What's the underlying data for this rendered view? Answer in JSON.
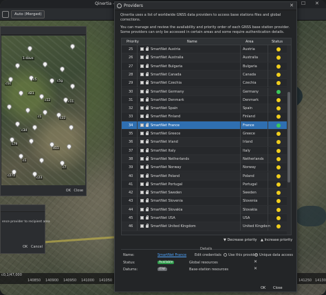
{
  "app": {
    "title": "Qinertia - C:\\",
    "toolbar_select": "Auto (Merged)",
    "min_icon": "—",
    "max_icon": "☐",
    "close_icon": "✕",
    "coordinates": "c0,1/47,000",
    "ruler": [
      "140850",
      "140900",
      "140950",
      "141000",
      "141050",
      "141100",
      "141150",
      "141200",
      "141250",
      "141300"
    ]
  },
  "left_dialog": {
    "ok": "OK",
    "close": "Close",
    "pins": [
      "1-dave",
      "c1s",
      "c5",
      "c2",
      "c5g",
      "c3",
      "d21",
      "c12",
      "c1c",
      "c5a",
      "c8",
      "c11",
      "c4",
      "c22",
      "c1",
      "c7e",
      "c3d",
      "c13",
      "rec",
      "c2",
      "c79",
      "c50",
      "d11",
      "c19",
      "c12",
      "c2",
      "c1",
      "c15",
      "c3d",
      "c9",
      "c7",
      "c5",
      "c17",
      "c23",
      "c10",
      "c12",
      "c272"
    ]
  },
  "small_dialog": {
    "message": "ence provider to recipient area",
    "ok": "OK",
    "cancel": "Cancel"
  },
  "providers": {
    "title": "Providers",
    "close_icon": "✕",
    "intro": "Qinertia uses a list of worldwide GNSS data providers to access base stations files and global corrections.",
    "intro2": "You can manage and review the availability and priority order of each GNSS base station provider. Some providers can only be accessed in certain areas and some require authentication details.",
    "columns": {
      "priority": "Priority",
      "name": "Name",
      "area": "Area",
      "status": "Status"
    },
    "rows": [
      {
        "priority": "25",
        "name": "SmartNet Austria",
        "area": "Austria",
        "status": "yellow"
      },
      {
        "priority": "26",
        "name": "SmartNet Australia",
        "area": "Australia",
        "status": "yellow"
      },
      {
        "priority": "27",
        "name": "SmartNet Bulgaria",
        "area": "Bulgaria",
        "status": "yellow"
      },
      {
        "priority": "28",
        "name": "SmartNet Canada",
        "area": "Canada",
        "status": "yellow"
      },
      {
        "priority": "29",
        "name": "SmartNet Czechia",
        "area": "Czechia",
        "status": "yellow"
      },
      {
        "priority": "30",
        "name": "SmartNet Germany",
        "area": "Germany",
        "status": "green"
      },
      {
        "priority": "31",
        "name": "SmartNet Denmark",
        "area": "Denmark",
        "status": "yellow"
      },
      {
        "priority": "32",
        "name": "SmartNet Spain",
        "area": "Spain",
        "status": "yellow"
      },
      {
        "priority": "33",
        "name": "SmartNet Finland",
        "area": "Finland",
        "status": "yellow"
      },
      {
        "priority": "34",
        "name": "SmartNet France",
        "area": "France",
        "status": "green",
        "selected": true
      },
      {
        "priority": "35",
        "name": "SmartNet Greece",
        "area": "Greece",
        "status": "yellow"
      },
      {
        "priority": "36",
        "name": "SmartNet Irland",
        "area": "Irland",
        "status": "yellow"
      },
      {
        "priority": "37",
        "name": "SmartNet Italy",
        "area": "Italy",
        "status": "yellow"
      },
      {
        "priority": "38",
        "name": "SmartNet Netherlands",
        "area": "Netherlands",
        "status": "yellow"
      },
      {
        "priority": "39",
        "name": "SmartNet Norway",
        "area": "Norway",
        "status": "yellow"
      },
      {
        "priority": "40",
        "name": "SmartNet Poland",
        "area": "Poland",
        "status": "yellow"
      },
      {
        "priority": "41",
        "name": "SmartNet Portugal",
        "area": "Portugal",
        "status": "yellow"
      },
      {
        "priority": "42",
        "name": "SmartNet Sweden",
        "area": "Sweden",
        "status": "yellow"
      },
      {
        "priority": "43",
        "name": "SmartNet Slovenia",
        "area": "Slovenia",
        "status": "yellow"
      },
      {
        "priority": "44",
        "name": "SmartNet Slovakia",
        "area": "Slovakia",
        "status": "yellow"
      },
      {
        "priority": "45",
        "name": "SmartNet USA",
        "area": "USA",
        "status": "yellow"
      },
      {
        "priority": "46",
        "name": "SmartNet United Kingdom",
        "area": "United Kingdom",
        "status": "yellow"
      }
    ],
    "status_colors": {
      "green": "#3cc85a",
      "yellow": "#f2cf1d",
      "selection": "#2f6fb1"
    },
    "decrease_priority": "Decrease priority",
    "increase_priority": "Increase priority",
    "details": {
      "title": "Details",
      "name_label": "Name:",
      "name_value": "SmartNet France",
      "edit_credentials": "Edit credentials",
      "use_provider": "Use this provider",
      "unique_data_access": "Unique data access",
      "status_label": "Status:",
      "status_value": "Available",
      "global_resources": "Global resources",
      "datums_label": "Datums:",
      "datums_value": "ITRF",
      "base_station_resources": "Base-station resources"
    },
    "ok": "OK",
    "close": "Close"
  }
}
